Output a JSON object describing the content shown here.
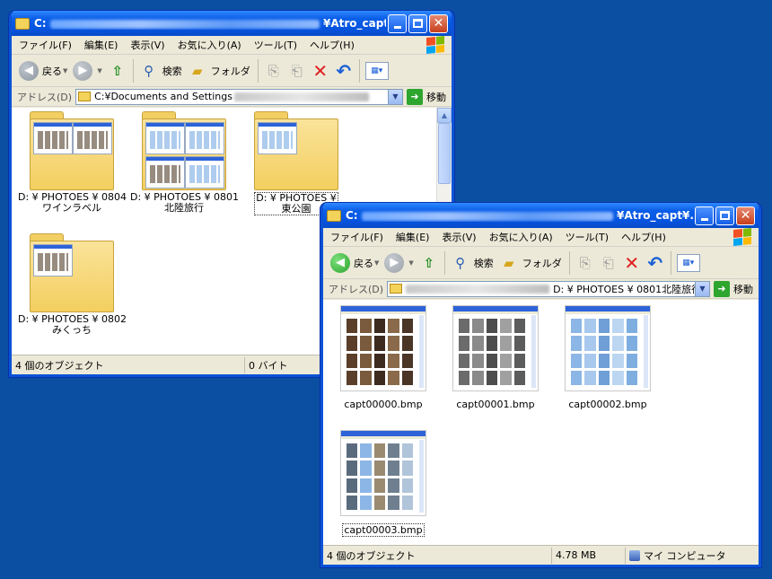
{
  "window1": {
    "title_prefix": "C:",
    "title_suffix": "¥Atro_capt",
    "menu": [
      "ファイル(F)",
      "編集(E)",
      "表示(V)",
      "お気に入り(A)",
      "ツール(T)",
      "ヘルプ(H)"
    ],
    "toolbar": {
      "back": "戻る",
      "search": "検索",
      "folders": "フォルダ"
    },
    "address": {
      "label": "アドレス(D)",
      "value": "C:¥Documents and Settings",
      "go": "移動"
    },
    "folders": [
      {
        "line1": "D: ¥ PHOTOES ¥ 0804",
        "line2": "ワインラベル"
      },
      {
        "line1": "D: ¥ PHOTOES ¥ 0801",
        "line2": "北陸旅行"
      },
      {
        "line1": "D: ¥ PHOTOES ¥",
        "line2": "東公園"
      },
      {
        "line1": "D: ¥ PHOTOES ¥ 0802",
        "line2": "みくっち"
      }
    ],
    "status": {
      "count": "4 個のオブジェクト",
      "size": "0 バイト"
    }
  },
  "window2": {
    "title_prefix": "C:",
    "title_suffix": "¥Atro_capt¥...",
    "menu": [
      "ファイル(F)",
      "編集(E)",
      "表示(V)",
      "お気に入り(A)",
      "ツール(T)",
      "ヘルプ(H)"
    ],
    "toolbar": {
      "back": "戻る",
      "search": "検索",
      "folders": "フォルダ"
    },
    "address": {
      "label": "アドレス(D)",
      "value": "D: ¥ PHOTOES ¥ 0801北陸旅行",
      "go": "移動"
    },
    "files": [
      {
        "name": "capt00000.bmp",
        "palette": "brown"
      },
      {
        "name": "capt00001.bmp",
        "palette": "gray"
      },
      {
        "name": "capt00002.bmp",
        "palette": "blue"
      },
      {
        "name": "capt00003.bmp",
        "palette": "mixed"
      }
    ],
    "status": {
      "count": "4 個のオブジェクト",
      "size": "4.78 MB",
      "location": "マイ コンピュータ"
    }
  },
  "colors": {
    "desktop": "#0b4fa3",
    "titlebar": "#0554e0",
    "window_bg": "#ece9d8"
  }
}
